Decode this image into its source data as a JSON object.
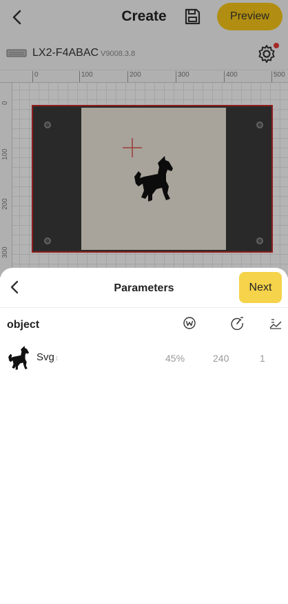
{
  "header": {
    "title": "Create",
    "preview_label": "Preview",
    "back_icon": "back-chevron-icon",
    "save_icon": "save-disk-icon"
  },
  "device": {
    "name": "LX2-F4ABAC",
    "version": "V9008.3.8",
    "icon": "laser-device-icon",
    "settings_icon": "gear-icon",
    "settings_badge_color": "#e53935"
  },
  "ruler": {
    "x_ticks": [
      "0",
      "100",
      "200",
      "300",
      "400",
      "500"
    ],
    "y_ticks": [
      "0",
      "100",
      "200",
      "300"
    ]
  },
  "sheet": {
    "title": "Parameters",
    "next_label": "Next",
    "columns": {
      "object_label": "object",
      "power_icon": "power-w-icon",
      "speed_icon": "speed-gauge-icon",
      "passes_icon": "passes-icon"
    },
    "rows": [
      {
        "name": "Svg",
        "name_suffix": "1",
        "power": "45%",
        "speed": "240",
        "passes": "1"
      }
    ]
  },
  "colors": {
    "accent": "#f5c518",
    "next_button": "#f5d34a",
    "bed_border": "#c62828"
  }
}
